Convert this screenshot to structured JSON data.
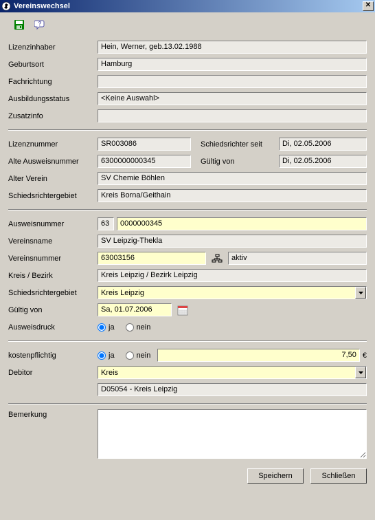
{
  "window": {
    "title": "Vereinswechsel"
  },
  "section1": {
    "lizenzinhaber_label": "Lizenzinhaber",
    "lizenzinhaber": "Hein, Werner, geb.13.02.1988",
    "geburtsort_label": "Geburtsort",
    "geburtsort": "Hamburg",
    "fachrichtung_label": "Fachrichtung",
    "fachrichtung": "",
    "ausbildungsstatus_label": "Ausbildungsstatus",
    "ausbildungsstatus": "<Keine Auswahl>",
    "zusatzinfo_label": "Zusatzinfo",
    "zusatzinfo": ""
  },
  "section2": {
    "lizenznummer_label": "Lizenznummer",
    "lizenznummer": "SR003086",
    "schiedsrichter_seit_label": "Schiedsrichter seit",
    "schiedsrichter_seit": "Di, 02.05.2006",
    "alte_ausweisnummer_label": "Alte Ausweisnummer",
    "alte_ausweisnummer": "6300000000345",
    "gueltig_von_label": "Gültig von",
    "gueltig_von": "Di, 02.05.2006",
    "alter_verein_label": "Alter Verein",
    "alter_verein": "SV Chemie Böhlen",
    "schiedsrichtergebiet_label": "Schiedsrichtergebiet",
    "schiedsrichtergebiet": "Kreis Borna/Geithain"
  },
  "section3": {
    "ausweisnummer_label": "Ausweisnummer",
    "ausweisnummer_prefix": "63",
    "ausweisnummer": "0000000345",
    "vereinsname_label": "Vereinsname",
    "vereinsname": "SV Leipzig-Thekla",
    "vereinsnummer_label": "Vereinsnummer",
    "vereinsnummer": "63003156",
    "vereinsstatus": "aktiv",
    "kreis_bezirk_label": "Kreis / Bezirk",
    "kreis_bezirk": "Kreis Leipzig / Bezirk Leipzig",
    "schiedsrichtergebiet_label": "Schiedsrichtergebiet",
    "schiedsrichtergebiet": "Kreis Leipzig",
    "gueltig_von_label": "Gültig von",
    "gueltig_von": "Sa, 01.07.2006",
    "ausweisdruck_label": "Ausweisdruck",
    "ja_label": "ja",
    "nein_label": "nein"
  },
  "section4": {
    "kostenpflichtig_label": "kostenpflichtig",
    "ja_label": "ja",
    "nein_label": "nein",
    "betrag": "7,50",
    "currency": "€",
    "debitor_label": "Debitor",
    "debitor": "Kreis",
    "debitor_detail": "D05054 - Kreis Leipzig"
  },
  "section5": {
    "bemerkung_label": "Bemerkung",
    "bemerkung": ""
  },
  "buttons": {
    "speichern": "Speichern",
    "schliessen": "Schließen"
  }
}
